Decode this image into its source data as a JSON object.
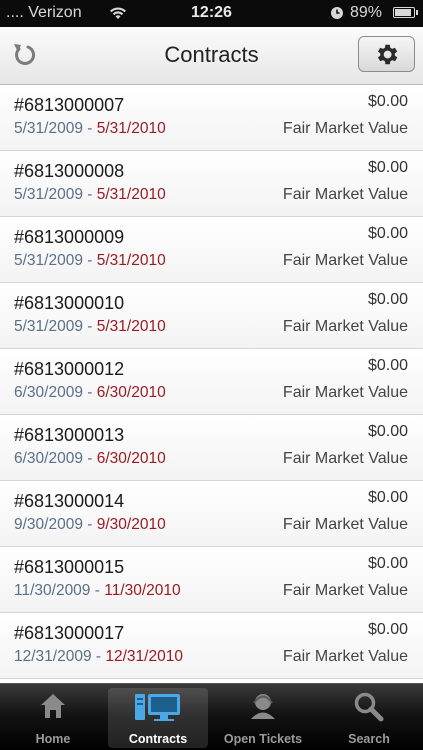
{
  "status_bar": {
    "carrier": ".... Verizon",
    "time": "12:26",
    "battery": "89%",
    "battery_level": 0.89
  },
  "header": {
    "title": "Contracts",
    "left_icon": "refresh-icon",
    "right_icon": "gear-icon"
  },
  "contracts": [
    {
      "number": "#6813000007",
      "start": "5/31/2009",
      "end": "5/31/2010",
      "amount": "$0.00",
      "type": "Fair Market Value"
    },
    {
      "number": "#6813000008",
      "start": "5/31/2009",
      "end": "5/31/2010",
      "amount": "$0.00",
      "type": "Fair Market Value"
    },
    {
      "number": "#6813000009",
      "start": "5/31/2009",
      "end": "5/31/2010",
      "amount": "$0.00",
      "type": "Fair Market Value"
    },
    {
      "number": "#6813000010",
      "start": "5/31/2009",
      "end": "5/31/2010",
      "amount": "$0.00",
      "type": "Fair Market Value"
    },
    {
      "number": "#6813000012",
      "start": "6/30/2009",
      "end": "6/30/2010",
      "amount": "$0.00",
      "type": "Fair Market Value"
    },
    {
      "number": "#6813000013",
      "start": "6/30/2009",
      "end": "6/30/2010",
      "amount": "$0.00",
      "type": "Fair Market Value"
    },
    {
      "number": "#6813000014",
      "start": "9/30/2009",
      "end": "9/30/2010",
      "amount": "$0.00",
      "type": "Fair Market Value"
    },
    {
      "number": "#6813000015",
      "start": "11/30/2009",
      "end": "11/30/2010",
      "amount": "$0.00",
      "type": "Fair Market Value"
    },
    {
      "number": "#6813000017",
      "start": "12/31/2009",
      "end": "12/31/2010",
      "amount": "$0.00",
      "type": "Fair Market Value"
    }
  ],
  "date_separator": " - ",
  "tabs": [
    {
      "label": "Home",
      "icon": "home-icon",
      "active": false
    },
    {
      "label": "Contracts",
      "icon": "contracts-icon",
      "active": true
    },
    {
      "label": "Open Tickets",
      "icon": "tickets-icon",
      "active": false
    },
    {
      "label": "Search",
      "icon": "search-icon",
      "active": false
    }
  ],
  "colors": {
    "start_date": "#5a7089",
    "end_date": "#9a1c22",
    "active_tab_icon": "#4aa8e6"
  }
}
